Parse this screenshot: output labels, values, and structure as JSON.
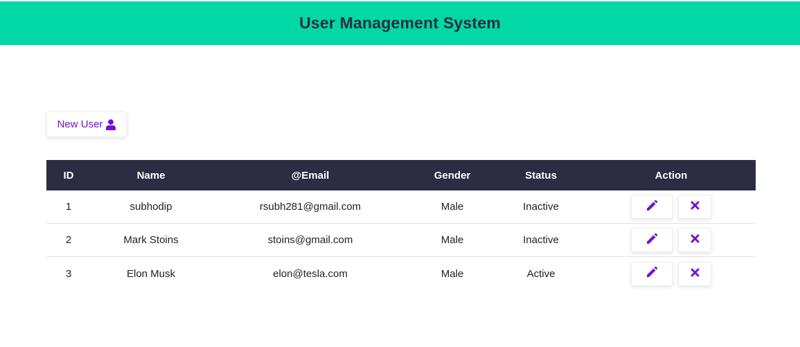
{
  "header": {
    "title": "User Management System"
  },
  "toolbar": {
    "new_user_label": "New User",
    "new_user_icon": "user-icon"
  },
  "colors": {
    "header_bg": "#00d9a5",
    "header_text": "#2b2d42",
    "table_head_bg": "#2b2d42",
    "accent": "#7410d6"
  },
  "table": {
    "columns": [
      "ID",
      "Name",
      "@Email",
      "Gender",
      "Status",
      "Action"
    ],
    "rows": [
      {
        "id": "1",
        "name": "subhodip",
        "email": "rsubh281@gmail.com",
        "gender": "Male",
        "status": "Inactive"
      },
      {
        "id": "2",
        "name": "Mark Stoins",
        "email": "stoins@gmail.com",
        "gender": "Male",
        "status": "Inactive"
      },
      {
        "id": "3",
        "name": "Elon Musk",
        "email": "elon@tesla.com",
        "gender": "Male",
        "status": "Active"
      }
    ],
    "row_actions": [
      {
        "name": "edit-button",
        "icon": "pencil-icon"
      },
      {
        "name": "delete-button",
        "icon": "close-icon"
      }
    ]
  }
}
